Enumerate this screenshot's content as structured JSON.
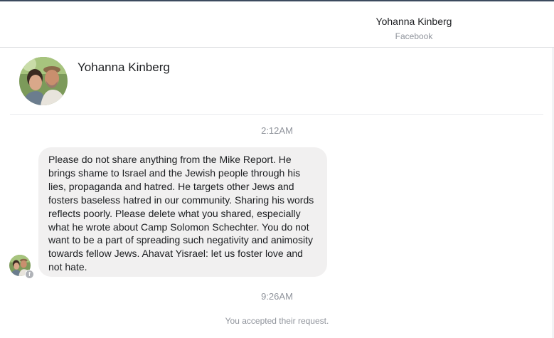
{
  "header": {
    "name": "Yohanna Kinberg",
    "subtitle": "Facebook"
  },
  "profile": {
    "name": "Yohanna Kinberg",
    "avatar_icon": "profile-photo"
  },
  "messages": [
    {
      "timestamp": "2:12AM"
    },
    {
      "text": "Please do not share anything from the Mike Report. He brings shame to Israel and the Jewish people through his lies, propaganda and hatred. He targets other Jews and fosters baseless hatred in our community. Sharing his words reflects poorly. Please delete what you shared, especially what he wrote about Camp Solomon Schechter. You do not want to be a part of spreading such negativity and animosity towards fellow Jews. Ahavat Yisrael: let us foster love and not hate."
    },
    {
      "timestamp": "9:26AM"
    }
  ],
  "system_message": "You accepted their request.",
  "colors": {
    "bubble": "#f1f0f0",
    "muted": "#90949c",
    "divider": "#dddfe2"
  }
}
